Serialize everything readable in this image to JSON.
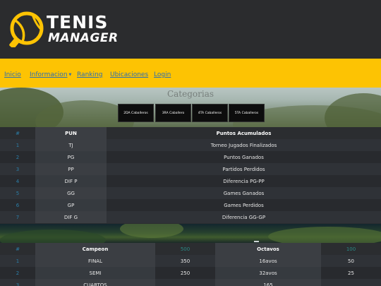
{
  "brand": {
    "word1": "TENIS",
    "word2": "MANAGER",
    "accent": "#fdc303"
  },
  "nav": {
    "items": [
      {
        "label": "Inicio"
      },
      {
        "label": "Informacion"
      },
      {
        "label": "Ranking"
      },
      {
        "label": "Ubicaciones"
      },
      {
        "label": "Login"
      }
    ]
  },
  "categories": {
    "title": "Categorias",
    "buttons": [
      {
        "label": "2DA Caballeros"
      },
      {
        "label": "3RA Caballero"
      },
      {
        "label": "4TA Caballeros"
      },
      {
        "label": "5TA Caballeros"
      }
    ]
  },
  "points_table": {
    "header": {
      "idx": "#",
      "code": "PUN",
      "desc": "Puntos Acumulados"
    },
    "rows": [
      {
        "idx": "1",
        "code": "TJ",
        "desc": "Torneo Jugados Finalizados"
      },
      {
        "idx": "2",
        "code": "PG",
        "desc": "Puntos Ganados"
      },
      {
        "idx": "3",
        "code": "PP",
        "desc": "Partidos Perdidos"
      },
      {
        "idx": "4",
        "code": "DIF P",
        "desc": "Diferencia PG-PP"
      },
      {
        "idx": "5",
        "code": "GG",
        "desc": "Games Ganados"
      },
      {
        "idx": "6",
        "code": "GP",
        "desc": "Games Perdidos"
      },
      {
        "idx": "7",
        "code": "DIF G",
        "desc": "Diferencia GG-GP"
      }
    ]
  },
  "scoring_table": {
    "header": {
      "idx": "#",
      "round_a": "Campeon",
      "pts_a": "500",
      "round_b": "Octavos",
      "pts_b": "100"
    },
    "rows": [
      {
        "idx": "1",
        "round_a": "FINAL",
        "pts_a": "350",
        "round_b": "16avos",
        "pts_b": "50"
      },
      {
        "idx": "2",
        "round_a": "SEMI",
        "pts_a": "250",
        "round_b": "32avos",
        "pts_b": "25"
      },
      {
        "idx": "3",
        "round_a": "CUARTOS",
        "pts_a": "",
        "round_b": "165",
        "pts_b": ""
      }
    ]
  }
}
